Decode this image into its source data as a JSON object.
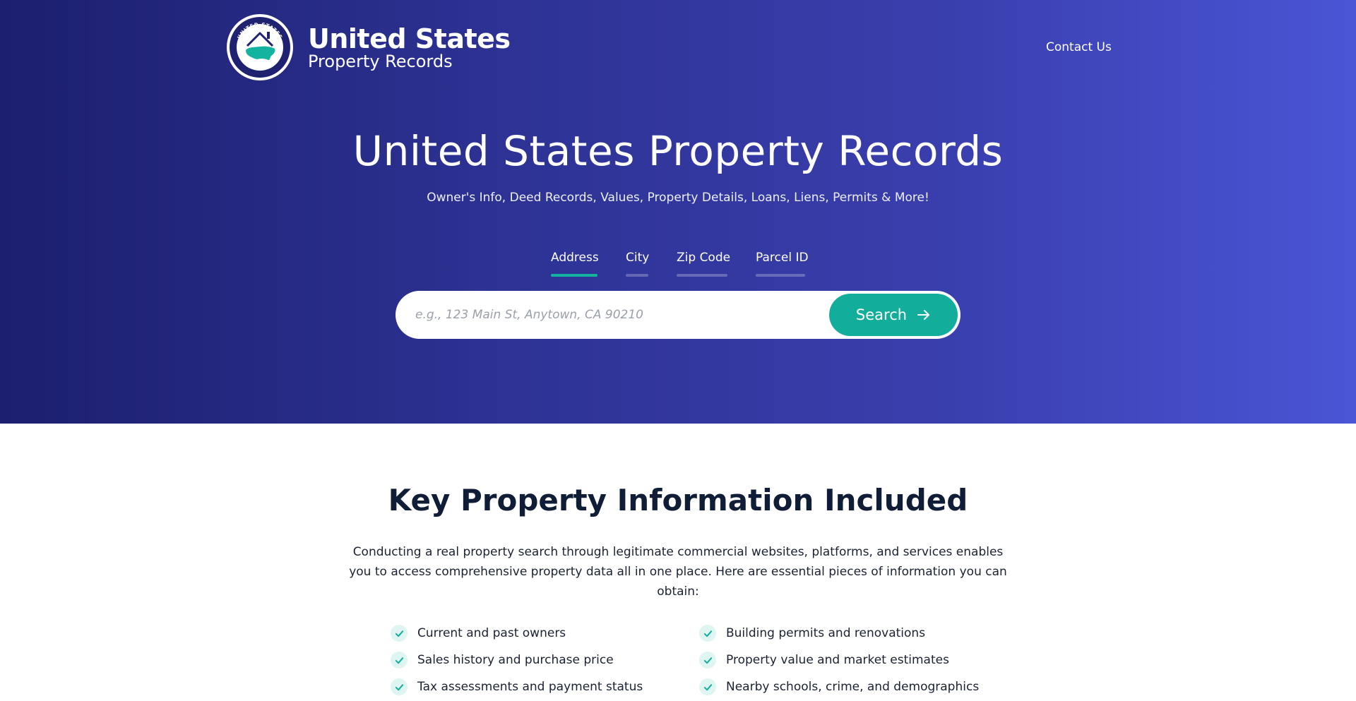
{
  "header": {
    "brand_title": "United States",
    "brand_subtitle": "Property Records",
    "logo_ring_text_top": "UNITED STATES",
    "logo_ring_text_bottom": "PROPERTY RECORDS",
    "contact_label": "Contact Us"
  },
  "hero": {
    "title": "United States Property Records",
    "subtitle": "Owner's Info, Deed Records, Values, Property Details, Loans, Liens, Permits & More!"
  },
  "tabs": [
    {
      "label": "Address",
      "active": true
    },
    {
      "label": "City",
      "active": false
    },
    {
      "label": "Zip Code",
      "active": false
    },
    {
      "label": "Parcel ID",
      "active": false
    }
  ],
  "search": {
    "placeholder": "e.g., 123 Main St, Anytown, CA 90210",
    "value": "",
    "button_label": "Search",
    "button_icon": "arrow-right-icon"
  },
  "info": {
    "title_bold": "Key",
    "title_rest": " Property Information Included",
    "description": "Conducting a real property search through legitimate commercial websites, platforms, and services enables you to access comprehensive property data all in one place. Here are essential pieces of information you can obtain:",
    "features_left": [
      "Current and past owners",
      "Sales history and purchase price",
      "Tax assessments and payment status"
    ],
    "features_right": [
      "Building permits and renovations",
      "Property value and market estimates",
      "Nearby schools, crime, and demographics"
    ]
  },
  "colors": {
    "accent": "#13ae9b",
    "hero_start": "#1c1f6e",
    "hero_end": "#4a55d6",
    "text_dark": "#0f1e36"
  }
}
